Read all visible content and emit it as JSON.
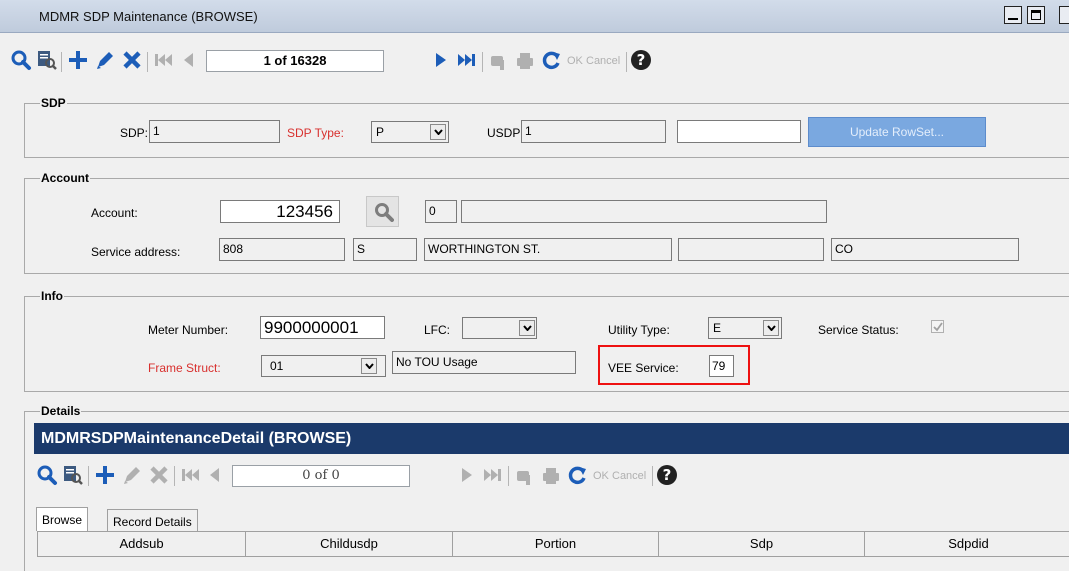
{
  "window": {
    "title": "MDMR SDP Maintenance (BROWSE)"
  },
  "toolbar": {
    "record_position": "1 of 16328",
    "ok_label": "OK",
    "cancel_label": "Cancel"
  },
  "sdp_section": {
    "label": "SDP",
    "sdp_label": "SDP:",
    "sdp_value": "1",
    "sdp_type_label": "SDP Type:",
    "sdp_type_value": "P",
    "usdp_label": "USDP:",
    "usdp_value": "1",
    "usdp_extra_value": "",
    "update_rowset_label": "Update RowSet..."
  },
  "account_section": {
    "label": "Account",
    "account_label": "Account:",
    "account_value": "123456",
    "account_code": "0",
    "account_name": "",
    "service_address_label": "Service address:",
    "address_number": "808",
    "address_direction": "S",
    "address_street": "WORTHINGTON ST.",
    "address_unit": "",
    "address_state": "CO"
  },
  "info_section": {
    "label": "Info",
    "meter_number_label": "Meter Number:",
    "meter_number_value": "9900000001",
    "lfc_label": "LFC:",
    "lfc_value": "",
    "utility_type_label": "Utility Type:",
    "utility_type_value": "E",
    "service_status_label": "Service Status:",
    "service_status_checked": true,
    "frame_struct_label": "Frame Struct:",
    "frame_struct_value": "01",
    "frame_struct_desc": "No TOU Usage",
    "vee_service_label": "VEE Service:",
    "vee_service_value": "79"
  },
  "details_section": {
    "label": "Details",
    "header_title": "MDMRSDPMaintenanceDetail (BROWSE)",
    "record_position": "0 of 0",
    "ok_label": "OK",
    "cancel_label": "Cancel",
    "tabs": [
      {
        "label": "Browse"
      },
      {
        "label": "Record Details"
      }
    ],
    "columns": [
      "Addsub",
      "Childusdp",
      "Portion",
      "Sdp",
      "Sdpdid"
    ]
  },
  "colors": {
    "accent_red": "#d8302e",
    "highlight": "#ee1111",
    "header_blue": "#1b3a6b",
    "icon_blue": "#1c5db8"
  }
}
